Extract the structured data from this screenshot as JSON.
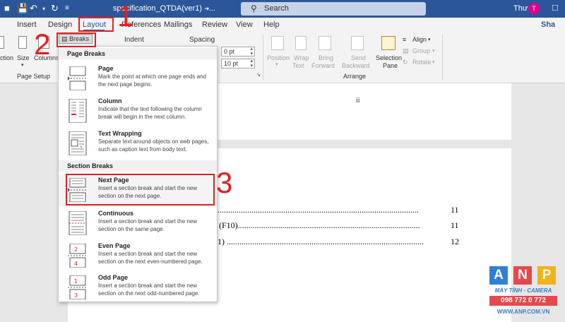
{
  "titlebar": {
    "doc_title": "specification_QTDA(ver1) - ...",
    "search_placeholder": "Search",
    "user_name": "Thư",
    "user_initial": "T",
    "brand_color": "#2b579a"
  },
  "tabs": [
    "Insert",
    "Design",
    "Layout",
    "References",
    "Mailings",
    "Review",
    "View",
    "Help"
  ],
  "share_label": "Sha",
  "ribbon": {
    "left_buttons": [
      "ction",
      "Size",
      "Columns"
    ],
    "breaks_label": "Breaks",
    "indent_label": "Indent",
    "spacing_label": "Spacing",
    "spacing_before": "0 pt",
    "spacing_after": "10 pt",
    "page_setup_label": "Page Setup",
    "arrange": {
      "position": "Position",
      "wrap_text": [
        "Wrap",
        "Text"
      ],
      "bring_forward": [
        "Bring",
        "Forward"
      ],
      "send_backward": [
        "Send",
        "Backward"
      ],
      "selection_pane": [
        "Selection",
        "Pane"
      ],
      "align": "Align",
      "group": "Group",
      "rotate": "Rotate",
      "group_label": "Arrange"
    }
  },
  "breaks_menu": {
    "page_breaks_header": "Page Breaks",
    "section_breaks_header": "Section Breaks",
    "page_items": [
      {
        "title": "Page",
        "desc": "Mark the point at which one page ends and the next page begins."
      },
      {
        "title": "Column",
        "desc": "Indicate that the text following the column break will begin in the next column."
      },
      {
        "title": "Text Wrapping",
        "desc": "Separate text around objects on web pages, such as caption text from body text."
      }
    ],
    "section_items": [
      {
        "title": "Next Page",
        "desc": "Insert a section break and start the new section on the next page."
      },
      {
        "title": "Continuous",
        "desc": "Insert a section break and start the new section on the same page."
      },
      {
        "title": "Even Page",
        "desc": "Insert a section break and start the new section on the next even-numbered page."
      },
      {
        "title": "Odd Page",
        "desc": "Insert a section break and start the new section on the next odd-numbered page."
      }
    ]
  },
  "document": {
    "page_roman": "ii",
    "toc_lines": [
      {
        "text": "...............................................................................................",
        "page": "11"
      },
      {
        "text": "(F10)......................................................................................",
        "page": "11"
      },
      {
        "text": "1) .............................................................................................",
        "page": "12"
      }
    ]
  },
  "steps": [
    "1",
    "2",
    "3"
  ],
  "watermark": {
    "letters": [
      "A",
      "N",
      "P"
    ],
    "tagline": "MÁY TÍNH · CAMERA",
    "phone": "098 772 0 772",
    "website": "WWW.ANP.COM.VN"
  }
}
